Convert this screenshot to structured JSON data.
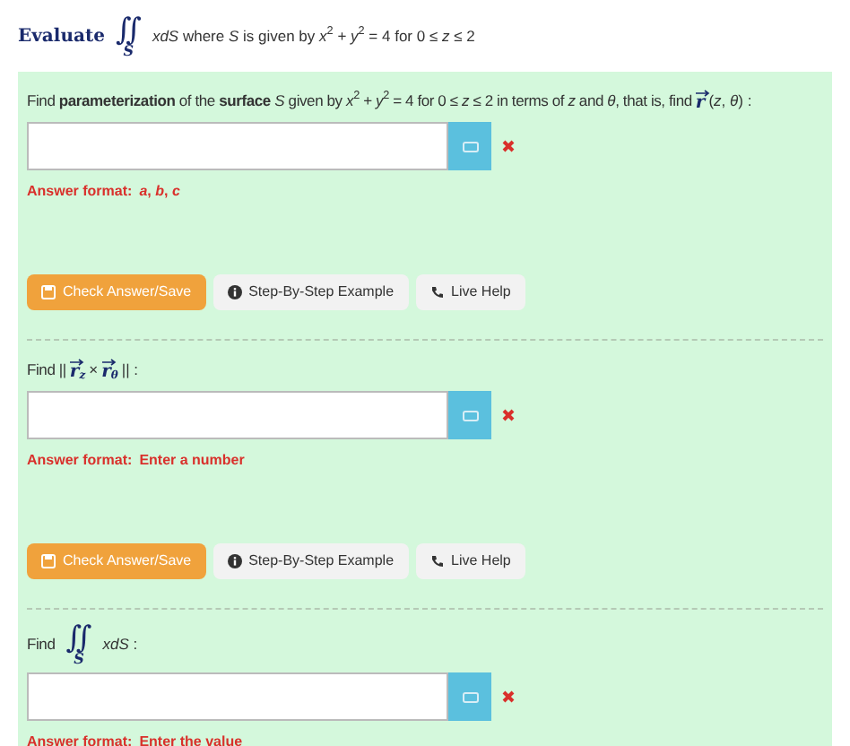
{
  "intro": [
    {
      "kind": "text",
      "text": "Evaluate"
    },
    {
      "kind": "integral",
      "sign": "∬",
      "sub": "S"
    },
    {
      "kind": "math",
      "text": "*xdS* where *S* is given by *x*$^{2}$ + *y*$^{2}$ = 4 for 0 ≤ *z* ≤ 2"
    }
  ],
  "parts": [
    {
      "question": [
        {
          "kind": "text",
          "text": "Find **parameterization** of the **surface** *S* given by *x*$^{2}$ + *y*$^{2}$ = 4 for 0 ≤ *z* ≤ 2 in terms of *z* and *θ*, that is, find"
        },
        {
          "kind": "vector",
          "letter": "r"
        },
        {
          "kind": "math",
          "text": "(*z*, *θ*) :"
        }
      ],
      "answer": {
        "marked_wrong": true
      },
      "format_label": "Answer format:",
      "format_value": "*a*, *b*, *c*",
      "buttons": [
        {
          "kind": "check",
          "label": "Check Answer/Save"
        },
        {
          "kind": "example",
          "label": "Step-By-Step Example"
        },
        {
          "kind": "help",
          "label": "Live Help"
        }
      ]
    },
    {
      "question": [
        {
          "kind": "text",
          "text": "Find ||"
        },
        {
          "kind": "vector",
          "letter": "r",
          "sub": "z"
        },
        {
          "kind": "math",
          "text": "×"
        },
        {
          "kind": "vector",
          "letter": "r",
          "sub": "θ"
        },
        {
          "kind": "math",
          "text": "|| :"
        }
      ],
      "answer": {
        "marked_wrong": true
      },
      "format_label": "Answer format:",
      "format_value": "Enter a number",
      "buttons": [
        {
          "kind": "check",
          "label": "Check Answer/Save"
        },
        {
          "kind": "example",
          "label": "Step-By-Step Example"
        },
        {
          "kind": "help",
          "label": "Live Help"
        }
      ]
    },
    {
      "question": [
        {
          "kind": "text",
          "text": "Find"
        },
        {
          "kind": "integral",
          "sign": "∬",
          "sub": "S"
        },
        {
          "kind": "math",
          "text": "*xdS* :"
        }
      ],
      "answer": {
        "marked_wrong": true
      },
      "format_label": "Answer format:",
      "format_value": "Enter the value"
    }
  ]
}
